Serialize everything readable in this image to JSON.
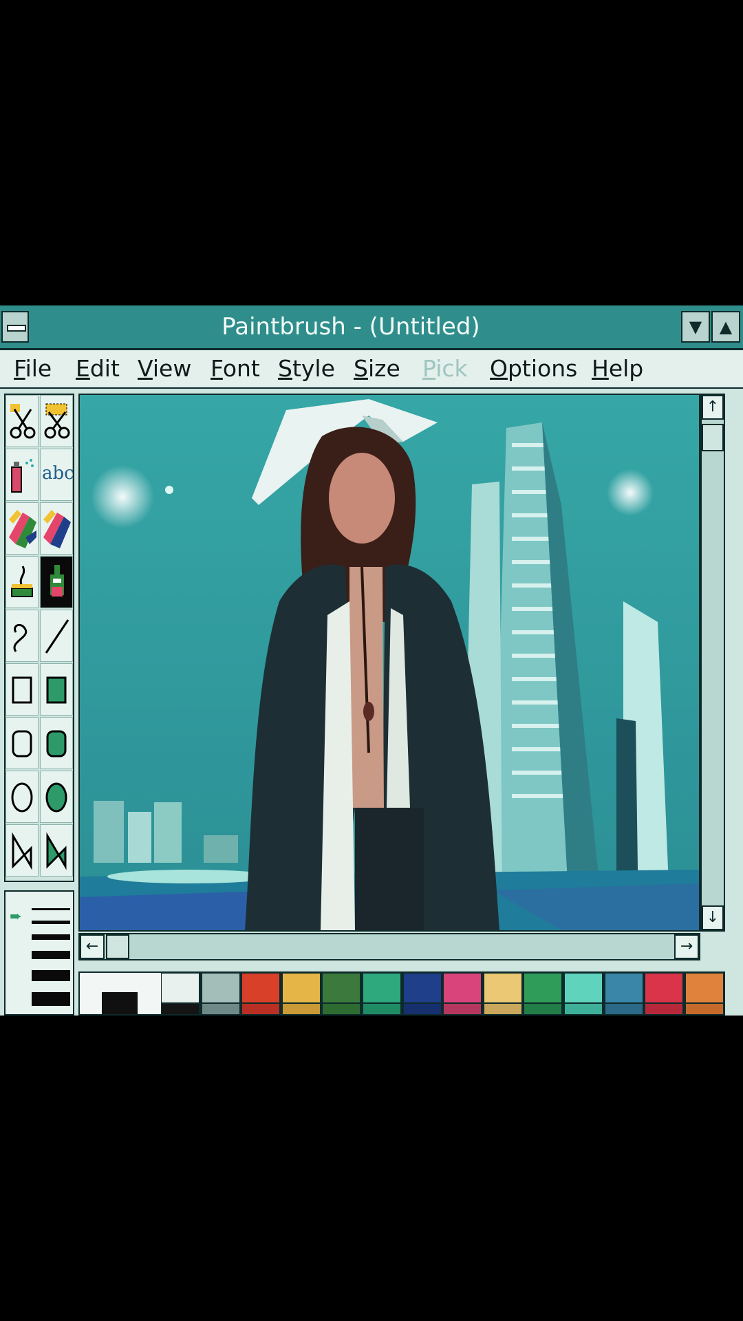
{
  "window": {
    "title": "Paintbrush - (Untitled)"
  },
  "menubar": {
    "items": [
      {
        "label": "File",
        "enabled": true
      },
      {
        "label": "Edit",
        "enabled": true
      },
      {
        "label": "View",
        "enabled": true
      },
      {
        "label": "Font",
        "enabled": true
      },
      {
        "label": "Style",
        "enabled": true
      },
      {
        "label": "Size",
        "enabled": true
      },
      {
        "label": "Pick",
        "enabled": false
      },
      {
        "label": "Options",
        "enabled": true
      },
      {
        "label": "Help",
        "enabled": true
      }
    ]
  },
  "toolbox": {
    "tools": [
      "scissors-icon",
      "pick-scissors-icon",
      "airbrush-icon",
      "text-tool-icon",
      "color-eraser-icon",
      "eraser-icon",
      "paint-roller-icon",
      "brush-icon",
      "curve-icon",
      "line-icon",
      "box-icon",
      "filled-box-icon",
      "rounded-box-icon",
      "filled-rounded-box-icon",
      "circle-icon",
      "filled-circle-icon",
      "polygon-icon",
      "filled-polygon-icon"
    ],
    "text_tool_glyph": "abc",
    "active_tool": "brush-icon"
  },
  "palette": {
    "top_row": [
      "#e9f1ef",
      "#a3bdb9",
      "#d8402a",
      "#e5b548",
      "#3b7a3c",
      "#2ea97e",
      "#1f3f8a",
      "#d9457a",
      "#ebc873",
      "#2f9c5a",
      "#5fd3bb",
      "#3a86a8",
      "#d9344a",
      "#e0823c"
    ],
    "bottom_row": [
      "#151515",
      "#6f8a86",
      "#b92f24",
      "#c99a36",
      "#2d6b31",
      "#208c66",
      "#16306e",
      "#b5375f",
      "#c9a75c",
      "#227d47",
      "#3eaf98",
      "#2b6a87",
      "#b8283b",
      "#c66a2c"
    ],
    "foreground": "#101010",
    "background": "#f2f6f4"
  },
  "scrollbars": {
    "up_arrow": "↑",
    "down_arrow": "↓",
    "left_arrow": "←",
    "right_arrow": "→"
  },
  "image": {
    "subject": "person-in-city-image"
  }
}
